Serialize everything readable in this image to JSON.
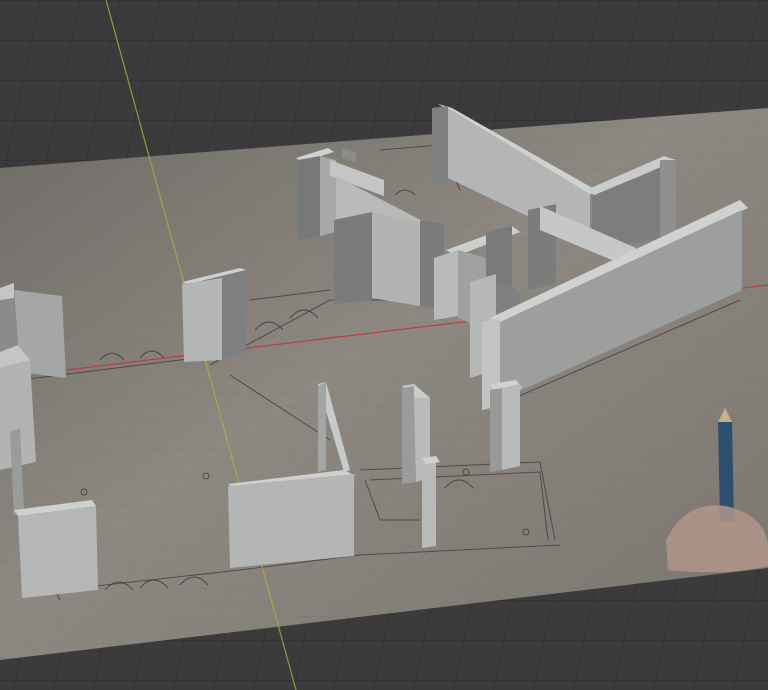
{
  "viewport": {
    "background_color": "#3a3a3a",
    "grid_line_color": "#2a2a2a",
    "x_axis_color": "#c83a3a",
    "y_axis_color": "#8fa83a"
  },
  "reference_image": {
    "description_icon": "paper-floor-plan",
    "paper_color": "#8c8780"
  },
  "walls": {
    "color_light": "#bdbfbf",
    "color_mid": "#a3a5a5",
    "color_dark": "#6e7070"
  },
  "pencil": {
    "icon": "pencil-icon",
    "color": "#2f4f6e"
  }
}
